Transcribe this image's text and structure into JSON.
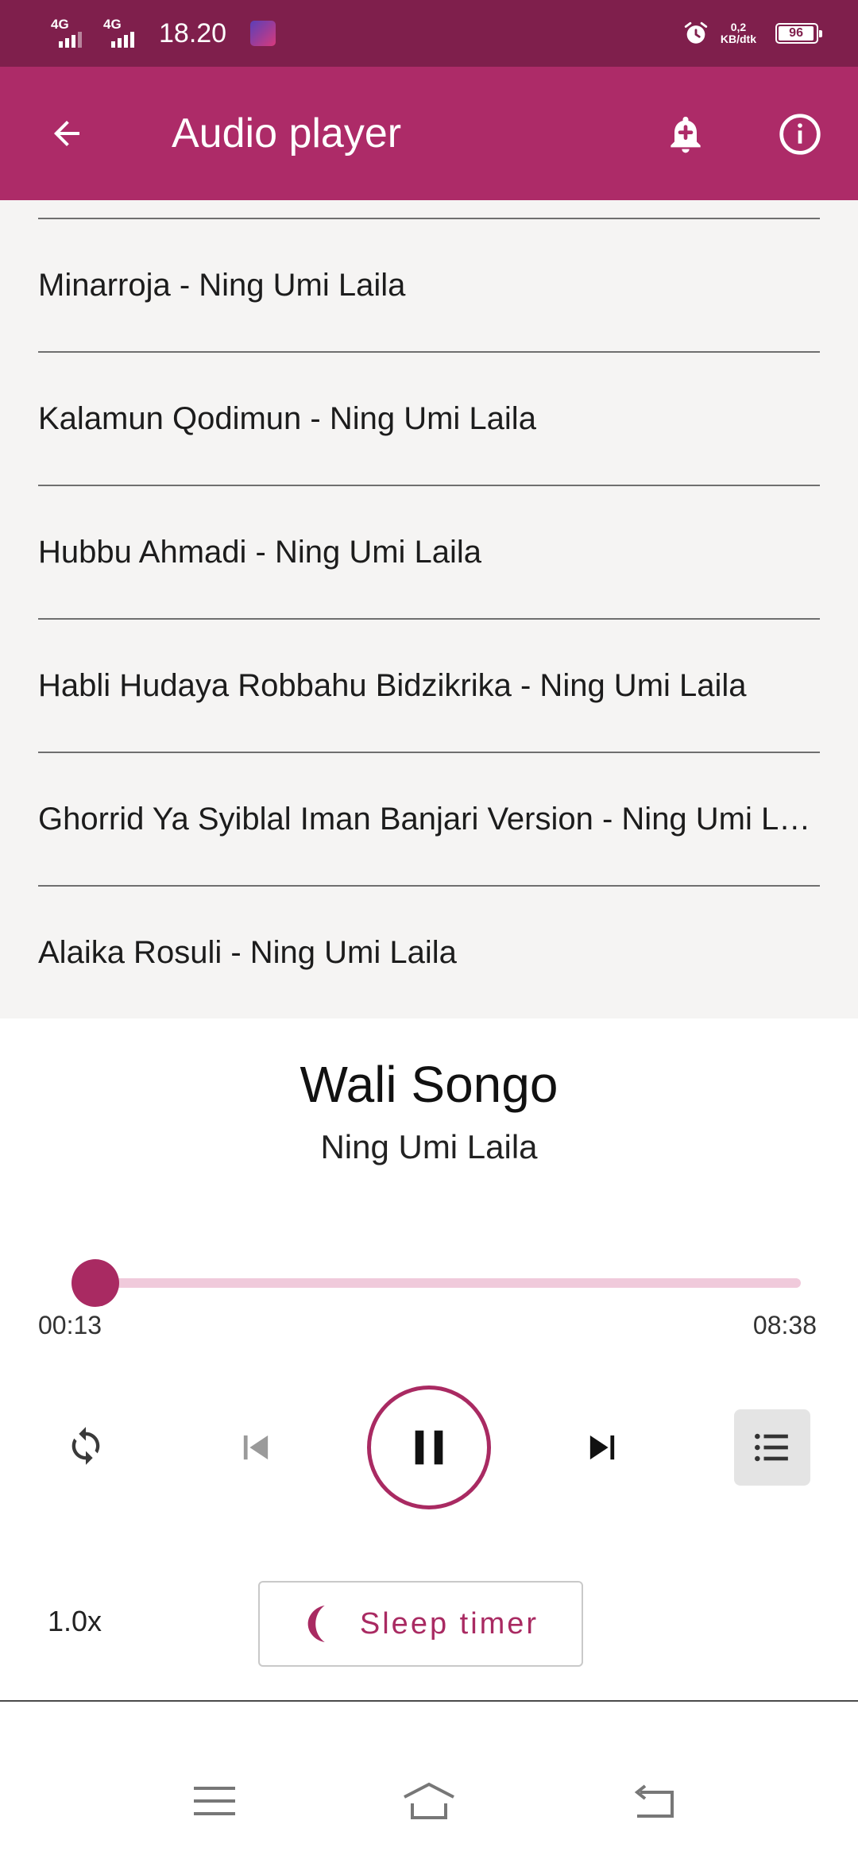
{
  "status_bar": {
    "signal1": "4G",
    "signal2": "4G",
    "time": "18.20",
    "net_speed_value": "0,2",
    "net_speed_unit": "KB/dtk",
    "battery": "96",
    "battery_level_percent": 96,
    "icons": [
      "signal-icon",
      "signal-icon",
      "app-notification-icon",
      "alarm-icon",
      "battery-icon"
    ]
  },
  "app_bar": {
    "title": "Audio player",
    "back_icon": "arrow-back-icon",
    "alarm_add_icon": "alarm-add-icon",
    "info_icon": "info-icon"
  },
  "playlist": {
    "items": [
      "Minarroja - Ning Umi Laila",
      "Kalamun Qodimun - Ning Umi Laila",
      "Hubbu Ahmadi - Ning Umi Laila",
      "Habli Hudaya Robbahu Bidzikrika - Ning Umi Laila",
      "Ghorrid Ya Syiblal Iman Banjari Version - Ning Umi Laila",
      "Alaika Rosuli - Ning Umi Laila"
    ]
  },
  "now_playing": {
    "title": "Wali Songo",
    "artist": "Ning Umi Laila",
    "elapsed": "00:13",
    "total": "08:38",
    "progress_fraction": 0.025
  },
  "controls": {
    "repeat_icon": "repeat-icon",
    "previous_icon": "skip-previous-icon",
    "pause_icon": "pause-icon",
    "next_icon": "skip-next-icon",
    "queue_icon": "queue-list-icon"
  },
  "bottom": {
    "speed": "1.0x",
    "sleep_timer_label": "Sleep timer",
    "sleep_icon": "moon-icon"
  },
  "nav": {
    "menu_icon": "menu-icon",
    "home_icon": "home-icon",
    "back_icon": "back-icon"
  },
  "colors": {
    "status_bar": "#7f1f4c",
    "app_bar": "#ad2b68",
    "accent": "#a92a62",
    "progress_track": "#f0cadb",
    "playlist_bg": "#f5f4f3"
  }
}
